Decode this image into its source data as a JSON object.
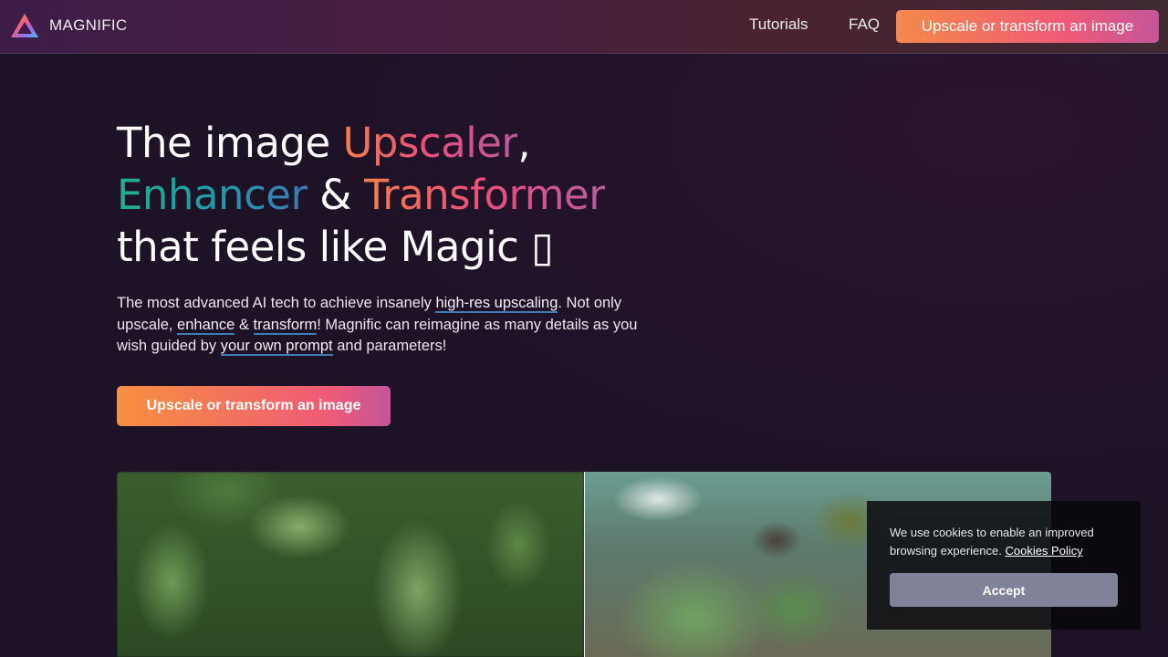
{
  "nav": {
    "brand": "MAGNIFIC",
    "links": [
      "Tutorials",
      "FAQ"
    ],
    "cta_label": "Upscale or transform an image"
  },
  "hero": {
    "title": {
      "line1_prefix": "The image ",
      "line1_highlight": "Upscaler",
      "line1_suffix": ",",
      "line2_highlight1": "Enhancer",
      "line2_mid": " & ",
      "line2_highlight2": "Transformer",
      "line3": "that feels like Magic ▯"
    },
    "description": {
      "part1": "The most advanced AI tech to achieve insanely ",
      "link1": "high-res upscaling",
      "part2": ". Not only upscale, ",
      "link2": "enhance",
      "part3": " & ",
      "link3": "transform",
      "part4": "! Magnific can reimagine as many details as you wish guided by ",
      "link4": "your own prompt",
      "part5": " and parameters!"
    },
    "cta_label": "Upscale or transform an image"
  },
  "comparison": {
    "left_image": "low-resolution jungle foliage",
    "right_image": "high-resolution river with waterfall and plants"
  },
  "cookie_banner": {
    "text": "We use cookies to enable an improved browsing experience. ",
    "link": "Cookies Policy",
    "accept_label": "Accept"
  },
  "colors": {
    "background": "#1e1226",
    "accent_orange": "#f5894a",
    "accent_pink": "#ef5a78",
    "accent_teal": "#22b08e",
    "link_underline": "#3f7bb4"
  }
}
